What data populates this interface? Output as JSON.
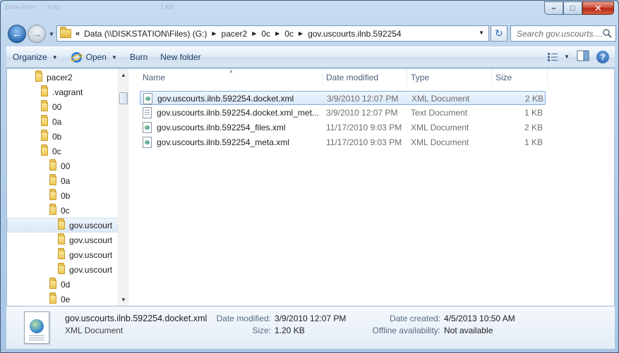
{
  "background_ghost": {
    "a": "Bilde-Filter",
    "b": "Foto",
    "c": "1 KB"
  },
  "caption": {
    "minimize": "–",
    "maximize": "□",
    "close": "✕"
  },
  "address": {
    "crumb_lead": "«",
    "crumbs": [
      "Data (\\\\DISKSTATION\\Files) (G:)",
      "pacer2",
      "0c",
      "0c",
      "gov.uscourts.ilnb.592254"
    ]
  },
  "search": {
    "placeholder": "Search gov.uscourts...."
  },
  "toolbar": {
    "organize": "Organize",
    "open": "Open",
    "burn": "Burn",
    "new_folder": "New folder",
    "help": "?"
  },
  "tree": [
    {
      "label": "pacer2",
      "indent": 0
    },
    {
      "label": ".vagrant",
      "indent": 1
    },
    {
      "label": "00",
      "indent": 1
    },
    {
      "label": "0a",
      "indent": 1
    },
    {
      "label": "0b",
      "indent": 1
    },
    {
      "label": "0c",
      "indent": 1
    },
    {
      "label": "00",
      "indent": 2
    },
    {
      "label": "0a",
      "indent": 2
    },
    {
      "label": "0b",
      "indent": 2
    },
    {
      "label": "0c",
      "indent": 2
    },
    {
      "label": "gov.uscourt",
      "indent": 3,
      "selected": true
    },
    {
      "label": "gov.uscourt",
      "indent": 3
    },
    {
      "label": "gov.uscourt",
      "indent": 3
    },
    {
      "label": "gov.uscourt",
      "indent": 3
    },
    {
      "label": "0d",
      "indent": 2
    },
    {
      "label": "0e",
      "indent": 2
    }
  ],
  "columns": {
    "name": "Name",
    "date": "Date modified",
    "type": "Type",
    "size": "Size"
  },
  "files": [
    {
      "name": "gov.uscourts.ilnb.592254.docket.xml",
      "date": "3/9/2010 12:07 PM",
      "type": "XML Document",
      "size": "2 KB",
      "icon": "xml-doc-icon",
      "selected": true
    },
    {
      "name": "gov.uscourts.ilnb.592254.docket.xml_met...",
      "date": "3/9/2010 12:07 PM",
      "type": "Text Document",
      "size": "1 KB",
      "icon": "text-doc-icon"
    },
    {
      "name": "gov.uscourts.ilnb.592254_files.xml",
      "date": "11/17/2010 9:03 PM",
      "type": "XML Document",
      "size": "2 KB",
      "icon": "xml-doc-icon"
    },
    {
      "name": "gov.uscourts.ilnb.592254_meta.xml",
      "date": "11/17/2010 9:03 PM",
      "type": "XML Document",
      "size": "1 KB",
      "icon": "xml-doc-icon"
    }
  ],
  "details": {
    "name": "gov.uscourts.ilnb.592254.docket.xml",
    "type": "XML Document",
    "date_modified_label": "Date modified:",
    "date_modified": "3/9/2010 12:07 PM",
    "size_label": "Size:",
    "size": "1.20 KB",
    "date_created_label": "Date created:",
    "date_created": "4/5/2013 10:50 AM",
    "offline_label": "Offline availability:",
    "offline": "Not available"
  },
  "colors": {
    "frame": "#b7d0ea",
    "selection": "#d9e9f9",
    "selection_border": "#84acdd"
  }
}
